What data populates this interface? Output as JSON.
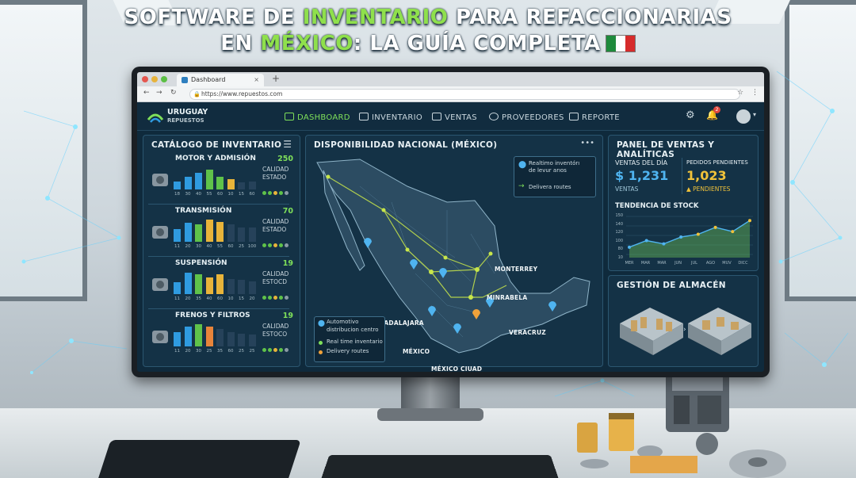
{
  "title": {
    "line1_pre": "SOFTWARE DE ",
    "line1_hl": "INVENTARIO",
    "line1_post": " PARA REFACCIONARIAS",
    "line2_pre": "EN ",
    "line2_hl": "MÉXICO",
    "line2_post": ": LA GUÍA COMPLETA"
  },
  "browser": {
    "tab_title": "Dashboard",
    "url": "https://www.repuestos.com"
  },
  "app": {
    "brand_line1": "URUGUAY",
    "brand_line2": "REPUESTOS",
    "nav": [
      {
        "label": "DASHBOARD",
        "active": true
      },
      {
        "label": "INVENTARIO",
        "active": false
      },
      {
        "label": "VENTAS",
        "active": false
      },
      {
        "label": "PROVEEDORES",
        "active": false
      },
      {
        "label": "REPORTE",
        "active": false
      }
    ],
    "notification_count": "2"
  },
  "catalog": {
    "title": "CATÁLOGO DE INVENTARIO",
    "categories": [
      {
        "name": "MOTOR Y ADMISIÓN",
        "count": "250",
        "quality": "CALIDAD",
        "status": "ESTADO",
        "ticks": [
          "18",
          "30",
          "40",
          "55",
          "60",
          "10",
          "15",
          "60"
        ],
        "bars": [
          0.35,
          0.55,
          0.7,
          0.85,
          0.55,
          0.45,
          0.3,
          0.35
        ],
        "colors": [
          "#2f9be0",
          "#2f9be0",
          "#2f9be0",
          "#5fc24a",
          "#5fc24a",
          "#e8b43a",
          "#26425a",
          "#26425a"
        ],
        "dots": [
          "#5fc24a",
          "#5fc24a",
          "#e8b43a",
          "#5fc24a",
          "#8a9aa5"
        ]
      },
      {
        "name": "TRANSMISIÓN",
        "count": "70",
        "quality": "CALIDAD",
        "status": "ESTADO",
        "ticks": [
          "11",
          "20",
          "30",
          "40",
          "55",
          "60",
          "25",
          "100"
        ],
        "bars": [
          0.55,
          0.8,
          0.75,
          0.95,
          0.85,
          0.75,
          0.6,
          0.6
        ],
        "colors": [
          "#2f9be0",
          "#2f9be0",
          "#5fc24a",
          "#e8b43a",
          "#e8b43a",
          "#26425a",
          "#26425a",
          "#26425a"
        ],
        "dots": [
          "#5fc24a",
          "#5fc24a",
          "#e8b43a",
          "#5fc24a",
          "#8a9aa5"
        ]
      },
      {
        "name": "SUSPENSIÓN",
        "count": "19",
        "quality": "CALIDAD",
        "status": "ESTOCD",
        "ticks": [
          "11",
          "20",
          "35",
          "40",
          "60",
          "10",
          "15",
          "20"
        ],
        "bars": [
          0.5,
          0.9,
          0.85,
          0.7,
          0.85,
          0.65,
          0.6,
          0.55
        ],
        "colors": [
          "#2f9be0",
          "#2f9be0",
          "#5fc24a",
          "#e8b43a",
          "#e8b43a",
          "#26425a",
          "#26425a",
          "#26425a"
        ],
        "dots": [
          "#5fc24a",
          "#5fc24a",
          "#e8b43a",
          "#5fc24a",
          "#8a9aa5"
        ]
      },
      {
        "name": "FRENOS Y FILTROS",
        "count": "19",
        "quality": "CALIDAD",
        "status": "ESTOCO",
        "ticks": [
          "11",
          "20",
          "30",
          "25",
          "35",
          "60",
          "25",
          "25"
        ],
        "bars": [
          0.6,
          0.85,
          0.95,
          0.85,
          0.75,
          0.6,
          0.55,
          0.5
        ],
        "colors": [
          "#2f9be0",
          "#2f9be0",
          "#5fc24a",
          "#e8843a",
          "#26425a",
          "#26425a",
          "#26425a",
          "#26425a"
        ],
        "dots": [
          "#5fc24a",
          "#5fc24a",
          "#e8b43a",
          "#5fc24a",
          "#8a9aa5"
        ]
      }
    ]
  },
  "map": {
    "title": "DISPONIBILIDAD NACIONAL (MÉXICO)",
    "more": "•••",
    "legend_top": {
      "line1": "Realtimo inventórı",
      "line2": "de levur arıos",
      "line3": "Delivera routes"
    },
    "legend_bottom": {
      "line1": "Automotivo",
      "line2": "distribucion centro",
      "line3": "Real time inventario",
      "line4": "Delivery routes"
    },
    "cities": [
      "MONTERREY",
      "MINRABELA",
      "GUADALAJARA",
      "VERACRUZ",
      "MÉXICO",
      "MÉXICO CIUAD"
    ]
  },
  "analytics": {
    "title": "PANEL DE VENTAS Y ANALÍTICAS",
    "sales_label": "VENTAS DEL DÍA",
    "sales_value": "$ 1,231",
    "sales_sub": "VENTAS",
    "pending_label": "PEDIDOS PENDIENTES",
    "pending_value": "1,023",
    "pending_sub": "▲ PENDIENTES",
    "trend_title": "TENDENCIA DE STOCK",
    "y_ticks": [
      "150",
      "140",
      "120",
      "100",
      "80",
      "10"
    ],
    "months": [
      "MER",
      "MAR",
      "MAR",
      "JUN",
      "JUL",
      "AGO",
      "MUV",
      "DICC"
    ]
  },
  "chart_data": {
    "type": "area",
    "title": "TENDENCIA DE STOCK",
    "categories": [
      "MER",
      "MAR",
      "MAR",
      "JUN",
      "JUL",
      "AGO",
      "MUV",
      "DICC"
    ],
    "series": [
      {
        "values": [
          38,
          62,
          50,
          75,
          85,
          110,
          95,
          135
        ]
      }
    ],
    "ylim": [
      0,
      150
    ]
  },
  "warehouse": {
    "title": "GESTIÓN DE ALMACÉN"
  },
  "colors": {
    "accent": "#7fe05a",
    "panel": "#143246",
    "border": "#2b5670",
    "blue": "#2f9be0",
    "amber": "#e8b43a"
  }
}
